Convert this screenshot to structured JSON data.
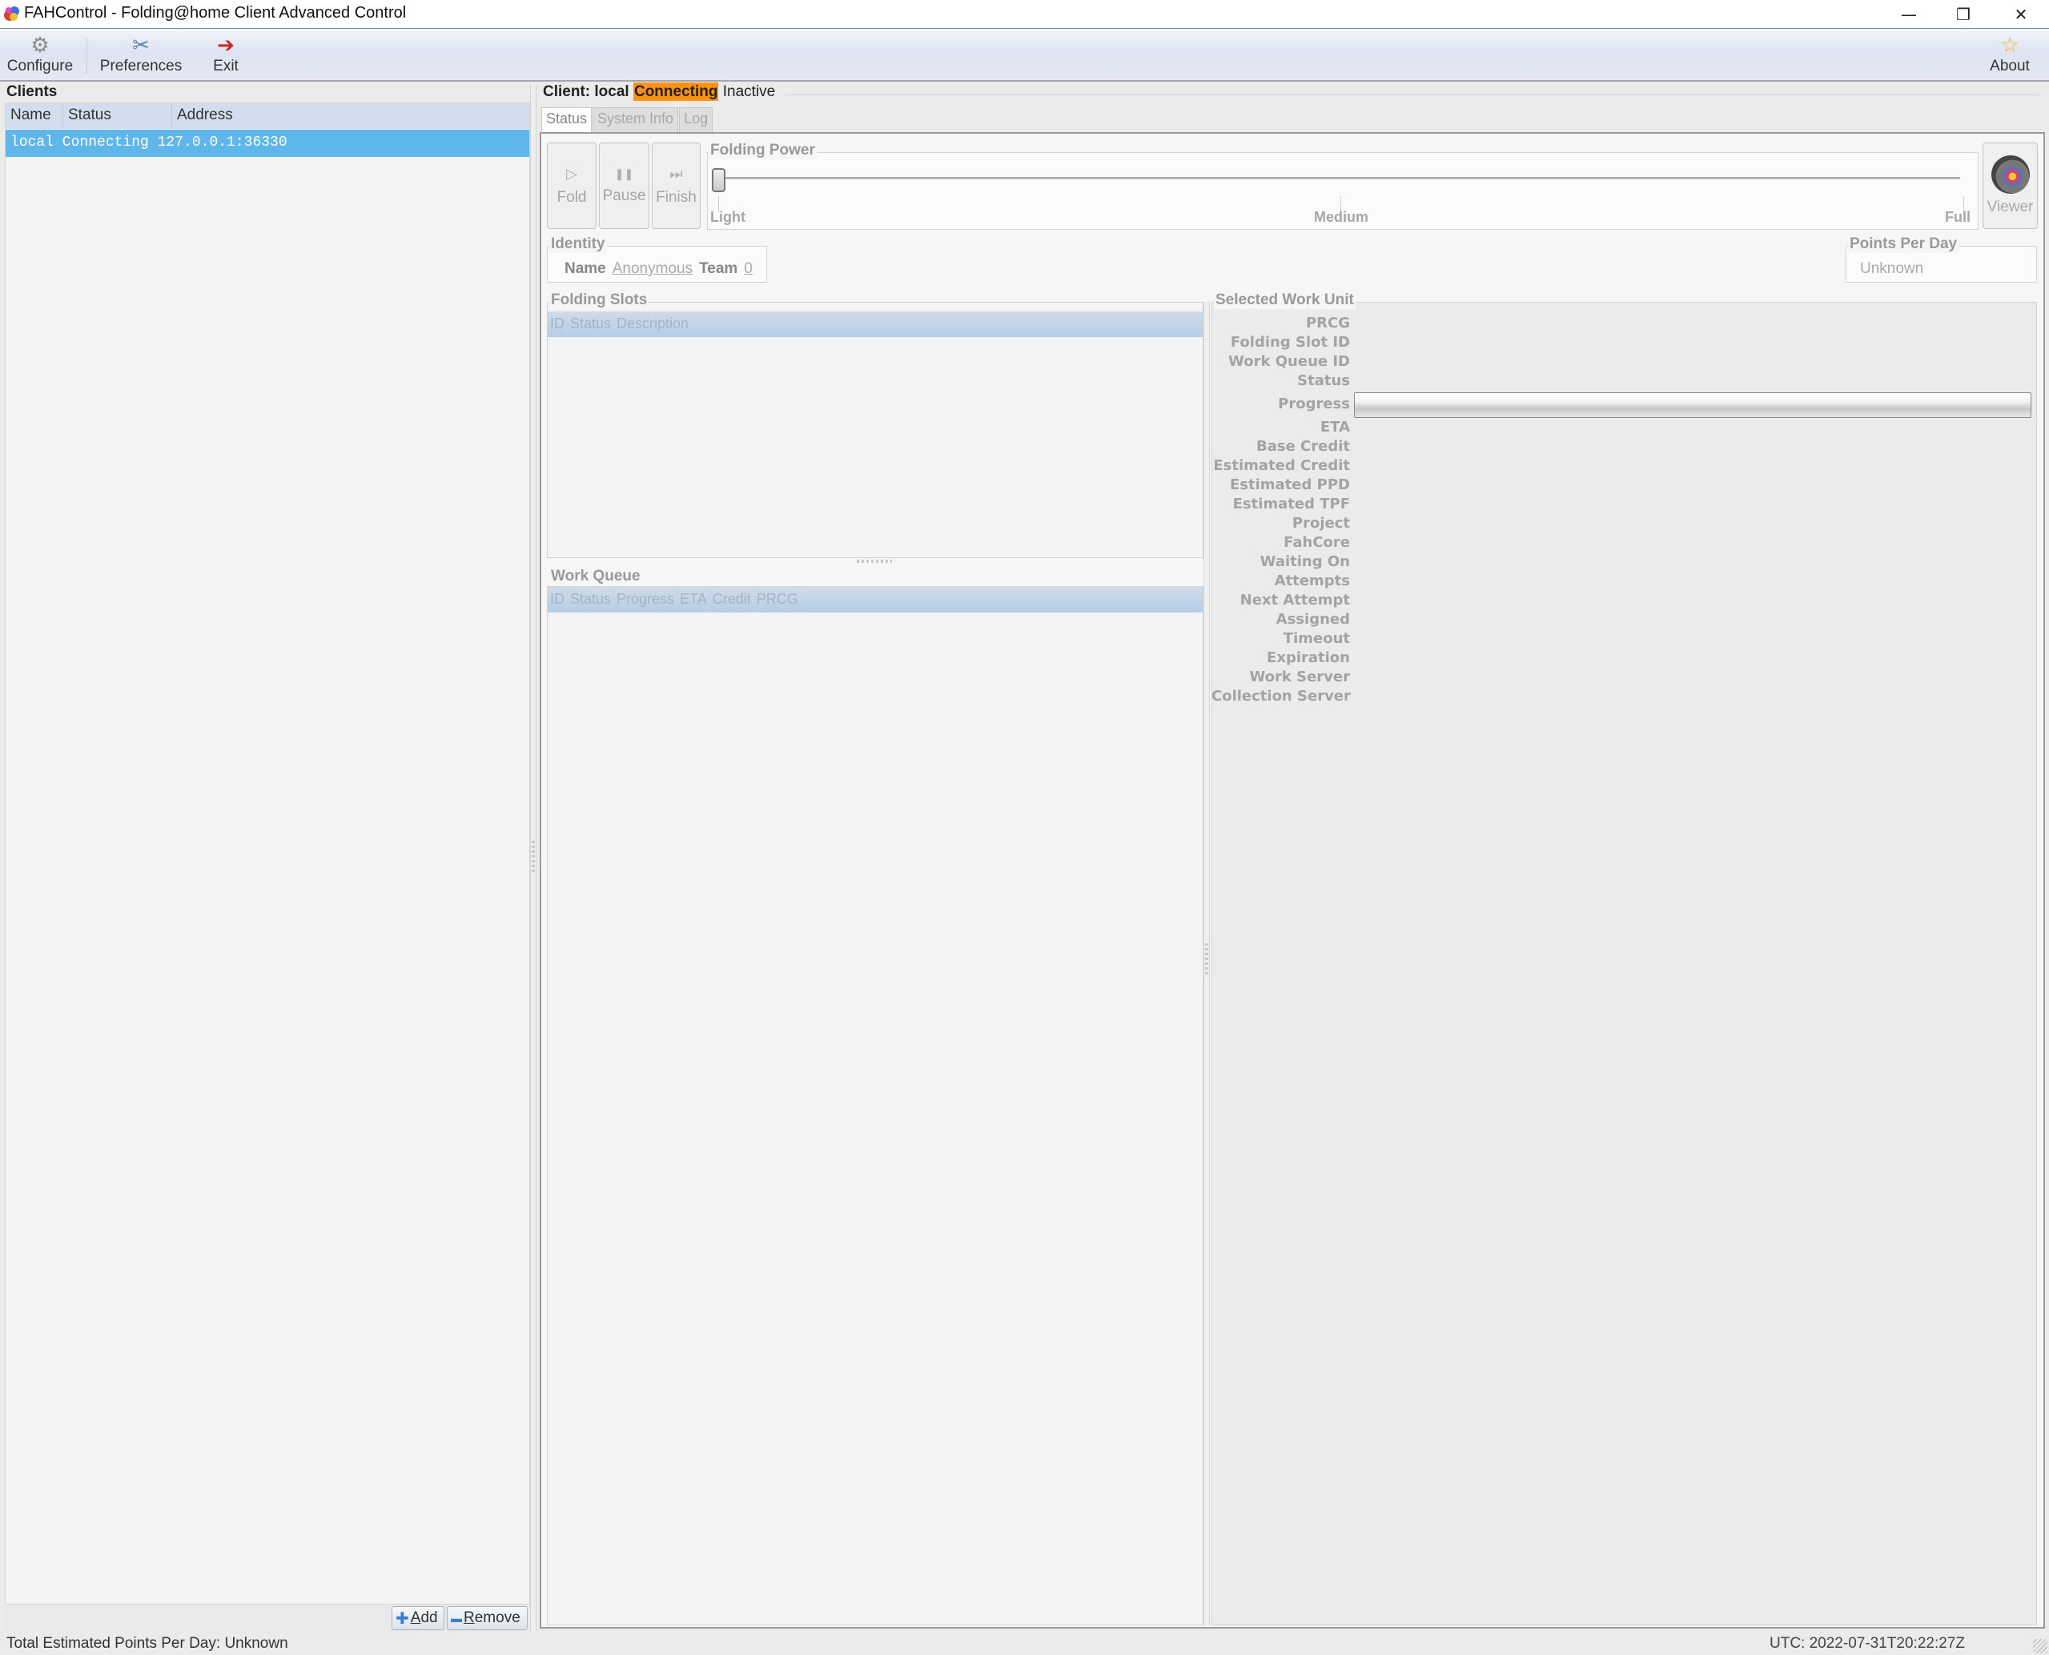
{
  "window": {
    "title": "FAHControl - Folding@home Client Advanced Control",
    "app_icon": "fah-logo-icon",
    "controls": {
      "minimize": "—",
      "restore": "❐",
      "close": "✕"
    }
  },
  "toolbar": {
    "configure": {
      "label": "Configure",
      "icon": "gear-icon",
      "glyph": "⚙"
    },
    "preferences": {
      "label": "Preferences",
      "icon": "tools-icon",
      "glyph": "✂"
    },
    "exit": {
      "label": "Exit",
      "icon": "exit-door-icon",
      "glyph": "➔"
    },
    "about": {
      "label": "About",
      "icon": "star-icon",
      "glyph": "☆"
    }
  },
  "clients": {
    "title": "Clients",
    "columns": [
      "Name",
      "Status",
      "Address"
    ],
    "rows": [
      {
        "name": "local",
        "status": "Connecting",
        "address": "127.0.0.1:36330",
        "text": "local Connecting 127.0.0.1:36330",
        "selected": true
      }
    ],
    "add_label": "Add",
    "add_mnemonic": "A",
    "add_rest": "dd",
    "remove_label": "Remove",
    "remove_mnemonic": "R",
    "remove_rest": "emove",
    "add_glyph": "✚",
    "remove_glyph": "▬"
  },
  "client_panel": {
    "prefix": "Client: local",
    "status": "Connecting",
    "state": "Inactive",
    "status_color": "#ff9212",
    "tabs": [
      {
        "label": "Status",
        "active": true
      },
      {
        "label": "System Info",
        "active": false
      },
      {
        "label": "Log",
        "active": false
      }
    ],
    "buttons": {
      "fold": {
        "label": "Fold",
        "glyph": "▷"
      },
      "pause": {
        "label": "Pause",
        "glyph": "❚❚"
      },
      "finish": {
        "label": "Finish",
        "glyph": "⏭"
      },
      "viewer": {
        "label": "Viewer"
      }
    },
    "folding_power": {
      "title": "Folding Power",
      "labels": [
        "Light",
        "Medium",
        "Full"
      ],
      "value_fraction": 0.0
    },
    "identity": {
      "title": "Identity",
      "name_label": "Name",
      "name_value": "Anonymous",
      "team_label": "Team",
      "team_value": "0"
    },
    "points_per_day": {
      "title": "Points Per Day",
      "value": "Unknown"
    },
    "folding_slots": {
      "title": "Folding Slots",
      "columns": [
        "ID",
        "Status",
        "Description"
      ],
      "rows": []
    },
    "work_queue": {
      "title": "Work Queue",
      "columns": [
        "ID",
        "Status",
        "Progress",
        "ETA",
        "Credit",
        "PRCG"
      ],
      "rows": []
    },
    "selected_work_unit": {
      "title": "Selected Work Unit",
      "fields": [
        "PRCG",
        "Folding Slot ID",
        "Work Queue ID",
        "Status",
        "Progress",
        "ETA",
        "Base Credit",
        "Estimated Credit",
        "Estimated PPD",
        "Estimated TPF",
        "Project",
        "FahCore",
        "Waiting On",
        "Attempts",
        "Next Attempt",
        "Assigned",
        "Timeout",
        "Expiration",
        "Work Server",
        "Collection Server"
      ],
      "progress_fraction": 0.0
    }
  },
  "statusbar": {
    "total_ppd": "Total Estimated Points Per Day: Unknown",
    "utc": "UTC: 2022-07-31T20:22:27Z"
  }
}
